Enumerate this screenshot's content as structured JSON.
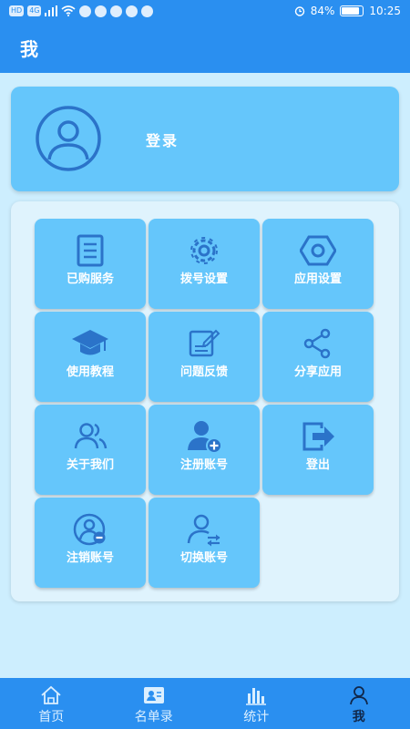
{
  "status_bar": {
    "left_badges": [
      "HD",
      "4G"
    ],
    "battery": "84%",
    "time": "10:25"
  },
  "app_bar": {
    "title": "我"
  },
  "login": {
    "label": "登录"
  },
  "grid": [
    {
      "label": "已购服务",
      "icon": "book-icon"
    },
    {
      "label": "拨号设置",
      "icon": "gear-icon"
    },
    {
      "label": "应用设置",
      "icon": "hex-nut-icon"
    },
    {
      "label": "使用教程",
      "icon": "graduation-cap-icon"
    },
    {
      "label": "问题反馈",
      "icon": "edit-note-icon"
    },
    {
      "label": "分享应用",
      "icon": "share-icon"
    },
    {
      "label": "关于我们",
      "icon": "people-icon"
    },
    {
      "label": "注册账号",
      "icon": "add-user-icon"
    },
    {
      "label": "登出",
      "icon": "logout-icon"
    },
    {
      "label": "注销账号",
      "icon": "remove-user-icon"
    },
    {
      "label": "切换账号",
      "icon": "switch-user-icon"
    }
  ],
  "bottom_nav": [
    {
      "label": "首页",
      "icon": "home-icon"
    },
    {
      "label": "名单录",
      "icon": "contact-card-icon"
    },
    {
      "label": "统计",
      "icon": "bar-chart-icon"
    },
    {
      "label": "我",
      "icon": "person-icon",
      "active": true
    }
  ],
  "colors": {
    "primary": "#2a8ff0",
    "tile": "#65c6fb",
    "page_bg": "#cdeefe",
    "icon_dark": "#2b73c9"
  }
}
